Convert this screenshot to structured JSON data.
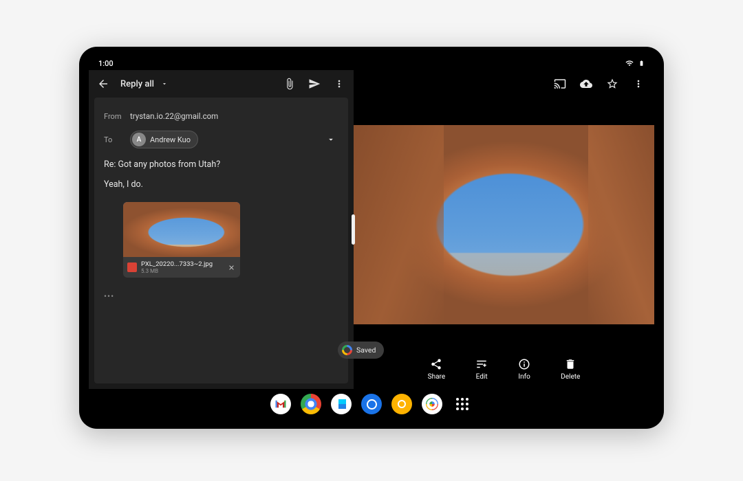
{
  "status": {
    "time": "1:00",
    "wifi": true,
    "battery": true
  },
  "gmail": {
    "back_icon": "arrow-back",
    "title": "Reply all",
    "attach_icon": "paperclip",
    "send_icon": "send",
    "menu_icon": "more-vert",
    "from_label": "From",
    "from_value": "trystan.io.22@gmail.com",
    "to_label": "To",
    "recipient": {
      "initial": "A",
      "name": "Andrew Kuo"
    },
    "subject": "Re: Got any photos from Utah?",
    "body": "Yeah, I do.",
    "attachment": {
      "filename": "PXL_20220...7333~2.jpg",
      "size": "5.3 MB"
    },
    "quoted_toggle": "•••"
  },
  "photos": {
    "cast_icon": "cast",
    "upload_icon": "cloud-upload",
    "star_icon": "star-outline",
    "menu_icon": "more-vert",
    "actions": {
      "share": "Share",
      "edit": "Edit",
      "info": "Info",
      "delete": "Delete"
    }
  },
  "saved_pill": "Saved",
  "taskbar": {
    "gmail": "Gmail",
    "chrome": "Chrome",
    "play": "Play Store",
    "camera": "Camera",
    "files": "Files",
    "photos": "Photos",
    "all_apps": "All apps"
  }
}
